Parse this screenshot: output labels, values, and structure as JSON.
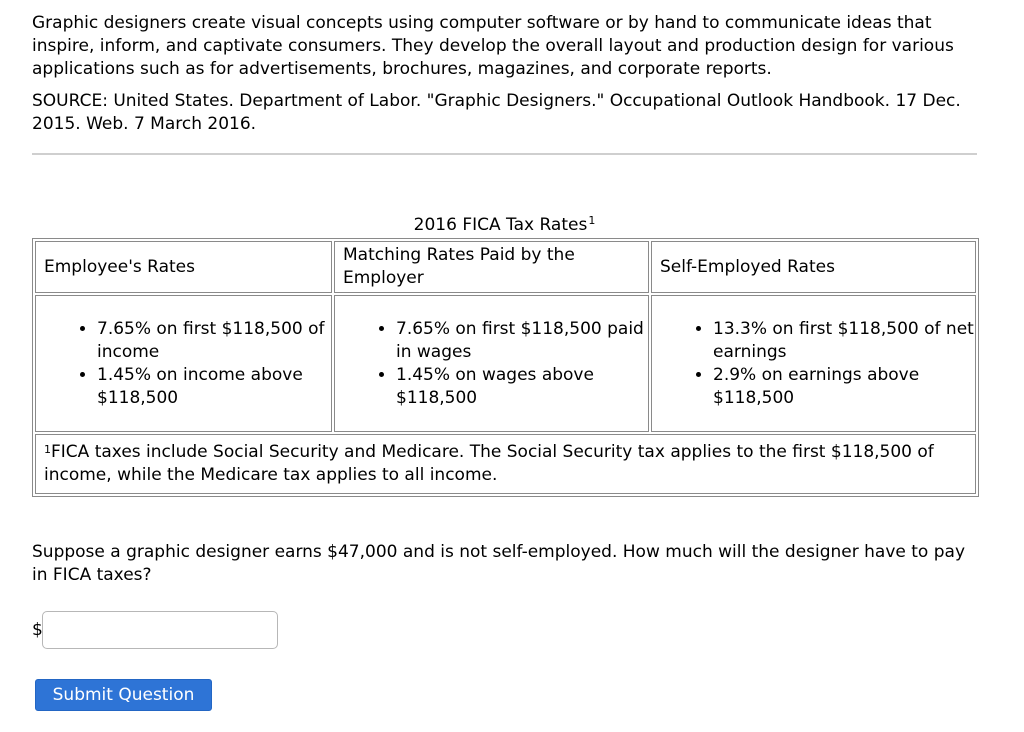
{
  "intro": {
    "text": "Graphic designers create visual concepts using computer software or by hand to communicate ideas that inspire, inform, and captivate consumers. They develop the overall layout and production design for various applications such as for advertisements, brochures, magazines, and corporate reports."
  },
  "source": {
    "text": "SOURCE: United States. Department of Labor. \"Graphic Designers.\" Occupational Outlook Handbook. 17 Dec. 2015. Web. 7 March 2016."
  },
  "table": {
    "caption": "2016 FICA Tax Rates",
    "caption_footnote_marker": "1",
    "headers": [
      "Employee's Rates",
      "Matching Rates Paid by the Employer",
      "Self-Employed Rates"
    ],
    "columns": [
      [
        "7.65% on first $118,500 of income",
        "1.45% on income above $118,500"
      ],
      [
        "7.65% on first $118,500 paid in wages",
        "1.45% on wages above $118,500"
      ],
      [
        "13.3% on first $118,500 of net earnings",
        "2.9% on earnings above $118,500"
      ]
    ],
    "footnote_marker": "1",
    "footnote": "FICA taxes include Social Security and Medicare. The Social Security tax applies to the first $118,500 of income, while the Medicare tax applies to all income."
  },
  "question": {
    "text": "Suppose a graphic designer earns $47,000 and is not self-employed. How much will the designer have to pay in FICA taxes?",
    "currency_symbol": "$",
    "answer_value": "",
    "answer_placeholder": ""
  },
  "actions": {
    "submit_label": "Submit Question"
  },
  "colors": {
    "submit_button": "#2e74d6",
    "divider": "#cfcfcf",
    "table_border": "#8a8a8a"
  }
}
